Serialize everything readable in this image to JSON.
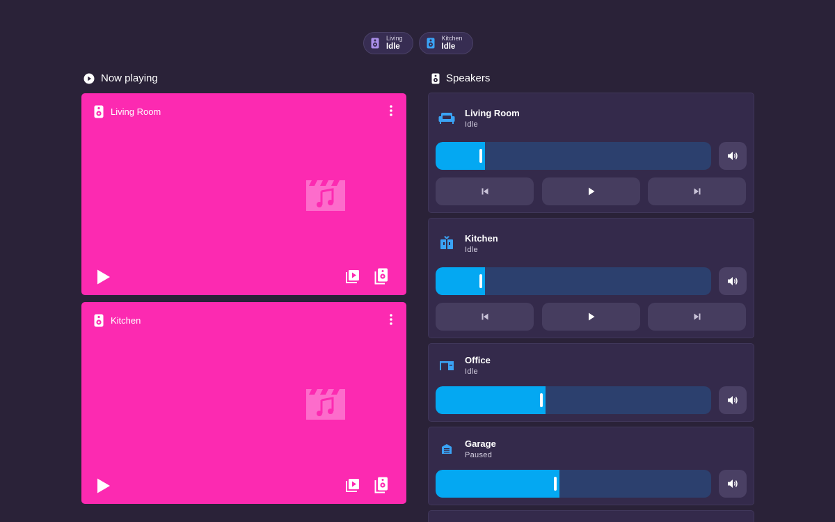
{
  "chips": [
    {
      "name": "Living",
      "state": "Idle",
      "color": "#a98ee8"
    },
    {
      "name": "Kitchen",
      "state": "Idle",
      "color": "#3aa3f5"
    }
  ],
  "sections": {
    "now_playing": "Now playing",
    "speakers": "Speakers"
  },
  "now_playing_cards": [
    {
      "name": "Living Room",
      "background": "#fc2ab1"
    },
    {
      "name": "Kitchen",
      "background": "#fc2ab1"
    }
  ],
  "speakers": [
    {
      "name": "Living Room",
      "state": "Idle",
      "icon": "sofa-icon",
      "volume_percent": 18
    },
    {
      "name": "Kitchen",
      "state": "Idle",
      "icon": "fridge-icon",
      "volume_percent": 18
    },
    {
      "name": "Office",
      "state": "Idle",
      "icon": "desk-icon",
      "volume_percent": 40
    },
    {
      "name": "Garage",
      "state": "Paused",
      "icon": "garage-icon",
      "volume_percent": 45
    }
  ],
  "colors": {
    "background": "#2a2238",
    "accent": "#04a8f2",
    "track": "#2c406e",
    "card": "#342a4b"
  }
}
